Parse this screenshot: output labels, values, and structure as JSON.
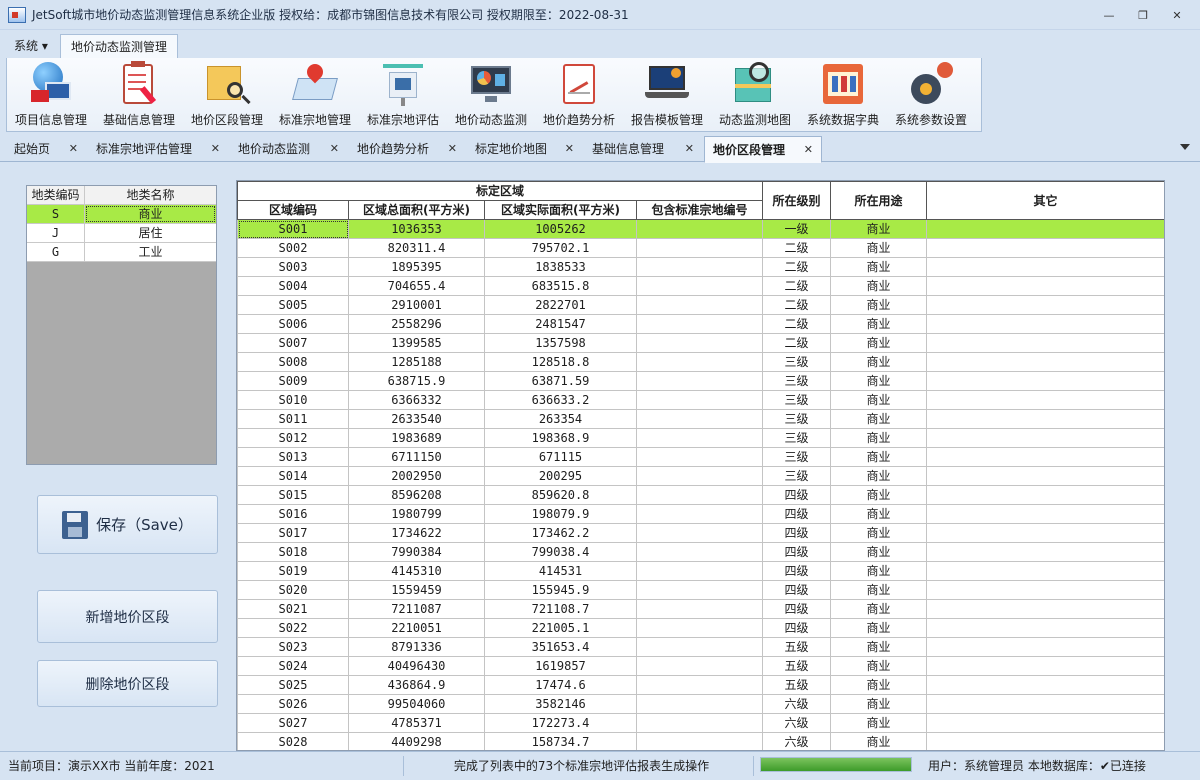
{
  "window": {
    "title": "JetSoft城市地价动态监测管理信息系统企业版   授权给：成都市锦图信息技术有限公司   授权期限至：2022-08-31",
    "minimize": "—",
    "maximize": "❐",
    "close": "✕"
  },
  "menu": {
    "system": "系统 ▾",
    "active_tab": "地价动态监测管理"
  },
  "ribbon": [
    {
      "label": "项目信息管理",
      "icon": "globe-computer-icon"
    },
    {
      "label": "基础信息管理",
      "icon": "clipboard-pen-icon"
    },
    {
      "label": "地价区段管理",
      "icon": "map-magnifier-icon"
    },
    {
      "label": "标准宗地管理",
      "icon": "map-pin-icon"
    },
    {
      "label": "标准宗地评估",
      "icon": "house-stack-icon"
    },
    {
      "label": "地价动态监测",
      "icon": "monitor-chart-icon"
    },
    {
      "label": "地价趋势分析",
      "icon": "trend-chart-icon"
    },
    {
      "label": "报告模板管理",
      "icon": "laptop-gear-icon"
    },
    {
      "label": "动态监测地图",
      "icon": "map-search-icon"
    },
    {
      "label": "系统数据字典",
      "icon": "dictionary-book-icon"
    },
    {
      "label": "系统参数设置",
      "icon": "gears-icon"
    }
  ],
  "doc_tabs": [
    {
      "label": "起始页",
      "active": false
    },
    {
      "label": "标准宗地评估管理",
      "active": false
    },
    {
      "label": "地价动态监测",
      "active": false
    },
    {
      "label": "地价趋势分析",
      "active": false
    },
    {
      "label": "标定地价地图",
      "active": false
    },
    {
      "label": "基础信息管理",
      "active": false
    },
    {
      "label": "地价区段管理",
      "active": true
    }
  ],
  "tab_close": "✕",
  "land_types": {
    "headers": [
      "地类编码",
      "地类名称"
    ],
    "rows": [
      {
        "code": "S",
        "name": "商业",
        "selected": true
      },
      {
        "code": "J",
        "name": "居住",
        "selected": false
      },
      {
        "code": "G",
        "name": "工业",
        "selected": false
      }
    ]
  },
  "buttons": {
    "save": "保存（Save）",
    "add": "新增地价区段",
    "delete": "删除地价区段"
  },
  "grid": {
    "group_header": "标定区域",
    "headers": [
      "区域编码",
      "区域总面积(平方米)",
      "区域实际面积(平方米)",
      "包含标准宗地编号",
      "所在级别",
      "所在用途",
      "其它"
    ],
    "rows": [
      [
        "S001",
        "1036353",
        "1005262",
        "",
        "一级",
        "商业",
        ""
      ],
      [
        "S002",
        "820311.4",
        "795702.1",
        "",
        "二级",
        "商业",
        ""
      ],
      [
        "S003",
        "1895395",
        "1838533",
        "",
        "二级",
        "商业",
        ""
      ],
      [
        "S004",
        "704655.4",
        "683515.8",
        "",
        "二级",
        "商业",
        ""
      ],
      [
        "S005",
        "2910001",
        "2822701",
        "",
        "二级",
        "商业",
        ""
      ],
      [
        "S006",
        "2558296",
        "2481547",
        "",
        "二级",
        "商业",
        ""
      ],
      [
        "S007",
        "1399585",
        "1357598",
        "",
        "二级",
        "商业",
        ""
      ],
      [
        "S008",
        "1285188",
        "128518.8",
        "",
        "三级",
        "商业",
        ""
      ],
      [
        "S009",
        "638715.9",
        "63871.59",
        "",
        "三级",
        "商业",
        ""
      ],
      [
        "S010",
        "6366332",
        "636633.2",
        "",
        "三级",
        "商业",
        ""
      ],
      [
        "S011",
        "2633540",
        "263354",
        "",
        "三级",
        "商业",
        ""
      ],
      [
        "S012",
        "1983689",
        "198368.9",
        "",
        "三级",
        "商业",
        ""
      ],
      [
        "S013",
        "6711150",
        "671115",
        "",
        "三级",
        "商业",
        ""
      ],
      [
        "S014",
        "2002950",
        "200295",
        "",
        "三级",
        "商业",
        ""
      ],
      [
        "S015",
        "8596208",
        "859620.8",
        "",
        "四级",
        "商业",
        ""
      ],
      [
        "S016",
        "1980799",
        "198079.9",
        "",
        "四级",
        "商业",
        ""
      ],
      [
        "S017",
        "1734622",
        "173462.2",
        "",
        "四级",
        "商业",
        ""
      ],
      [
        "S018",
        "7990384",
        "799038.4",
        "",
        "四级",
        "商业",
        ""
      ],
      [
        "S019",
        "4145310",
        "414531",
        "",
        "四级",
        "商业",
        ""
      ],
      [
        "S020",
        "1559459",
        "155945.9",
        "",
        "四级",
        "商业",
        ""
      ],
      [
        "S021",
        "7211087",
        "721108.7",
        "",
        "四级",
        "商业",
        ""
      ],
      [
        "S022",
        "2210051",
        "221005.1",
        "",
        "四级",
        "商业",
        ""
      ],
      [
        "S023",
        "8791336",
        "351653.4",
        "",
        "五级",
        "商业",
        ""
      ],
      [
        "S024",
        "40496430",
        "1619857",
        "",
        "五级",
        "商业",
        ""
      ],
      [
        "S025",
        "436864.9",
        "17474.6",
        "",
        "五级",
        "商业",
        ""
      ],
      [
        "S026",
        "99504060",
        "3582146",
        "",
        "六级",
        "商业",
        ""
      ],
      [
        "S027",
        "4785371",
        "172273.4",
        "",
        "六级",
        "商业",
        ""
      ],
      [
        "S028",
        "4409298",
        "158734.7",
        "",
        "六级",
        "商业",
        ""
      ]
    ]
  },
  "status": {
    "project": "当前项目：演示XX市   当前年度：2021",
    "message": "完成了列表中的73个标准宗地评估报表生成操作",
    "progress": 1.0,
    "user": "用户：系统管理员  本地数据库：✔已连接"
  },
  "colors": {
    "selection": "#a8ea46",
    "chrome": "#d6e3f2",
    "progress": "#3d9b2a"
  }
}
